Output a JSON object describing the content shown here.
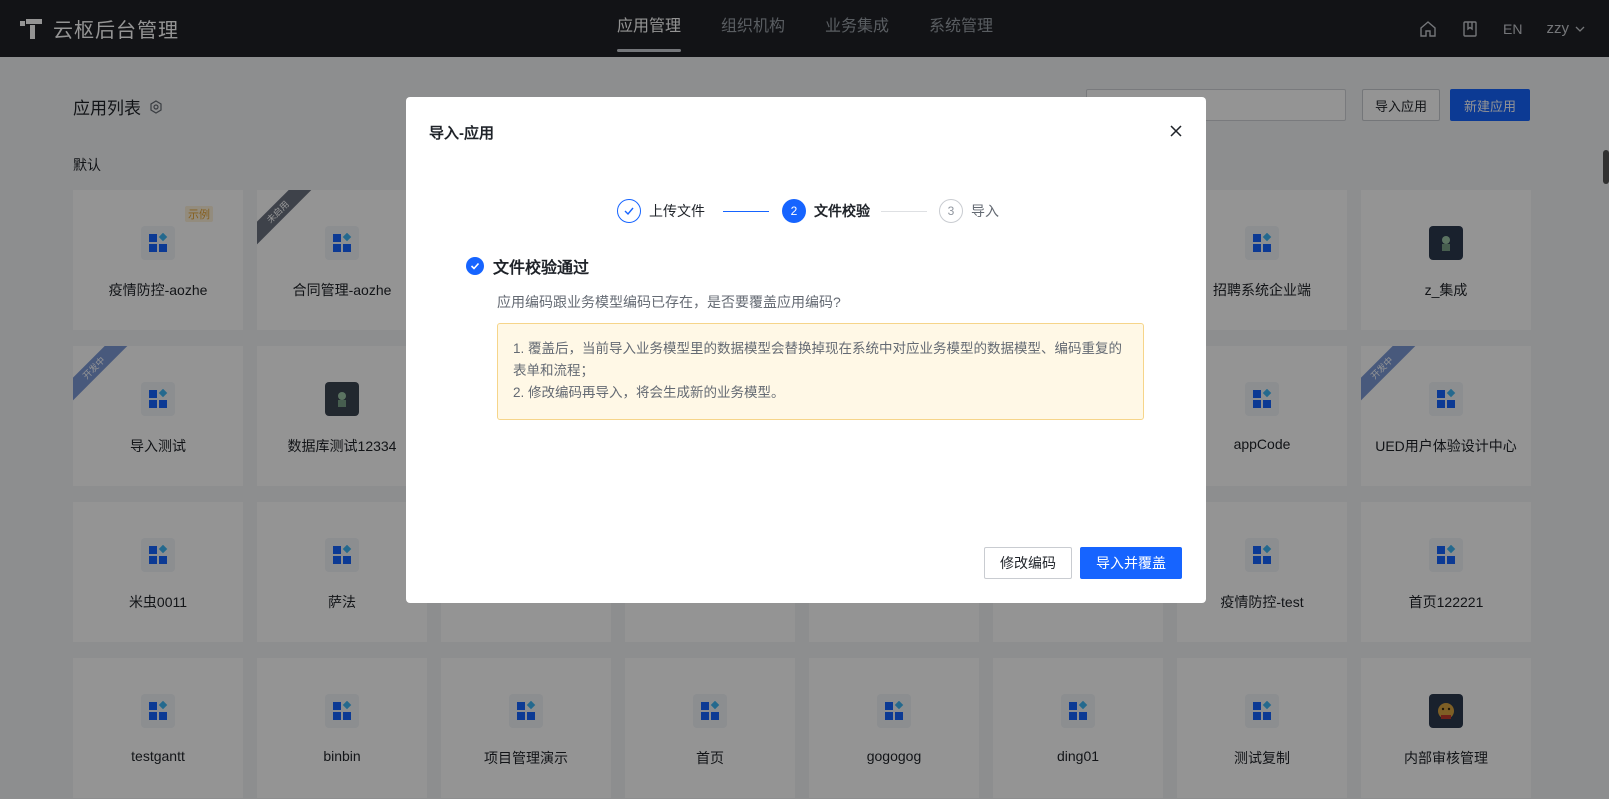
{
  "app": {
    "title": "云枢后台管理"
  },
  "nav": {
    "items": [
      "应用管理",
      "组织机构",
      "业务集成",
      "系统管理"
    ],
    "active": "应用管理"
  },
  "topbar": {
    "home_icon": "home-icon",
    "book_icon": "book-icon",
    "lang": "EN",
    "user": "zzy"
  },
  "page": {
    "title": "应用列表",
    "import_label": "导入应用",
    "new_label": "新建应用",
    "group_label": "默认"
  },
  "cards": [
    {
      "name": "疫情防控-aozhe",
      "badge": "示例",
      "ribbon": "",
      "icon": "apps-icon"
    },
    {
      "name": "合同管理-aozhe",
      "badge": "",
      "ribbon": "未启用",
      "icon": "apps-icon"
    },
    {
      "name": "招聘系统企业端",
      "badge": "",
      "ribbon": "",
      "icon": "apps-icon"
    },
    {
      "name": "z_集成",
      "badge": "",
      "ribbon": "",
      "icon": "image-icon"
    },
    {
      "name": "导入测试",
      "badge": "",
      "ribbon": "开发中",
      "icon": "apps-icon"
    },
    {
      "name": "数据库测试12334",
      "badge": "",
      "ribbon": "",
      "icon": "image-icon"
    },
    {
      "name": "appCode",
      "badge": "",
      "ribbon": "",
      "icon": "apps-icon"
    },
    {
      "name": "UED用户体验设计中心",
      "badge": "",
      "ribbon": "开发中",
      "icon": "apps-icon"
    },
    {
      "name": "米虫0011",
      "badge": "",
      "ribbon": "",
      "icon": "apps-icon"
    },
    {
      "name": "萨法",
      "badge": "",
      "ribbon": "",
      "icon": "apps-icon"
    },
    {
      "name": "疫情防控-test",
      "badge": "",
      "ribbon": "",
      "icon": "apps-icon"
    },
    {
      "name": "首页122221",
      "badge": "",
      "ribbon": "",
      "icon": "apps-icon"
    },
    {
      "name": "testgantt",
      "badge": "",
      "ribbon": "",
      "icon": "apps-icon"
    },
    {
      "name": "binbin",
      "badge": "",
      "ribbon": "",
      "icon": "apps-icon"
    },
    {
      "name": "项目管理演示",
      "badge": "",
      "ribbon": "",
      "icon": "apps-icon"
    },
    {
      "name": "首页",
      "badge": "",
      "ribbon": "",
      "icon": "apps-icon"
    },
    {
      "name": "gogogog",
      "badge": "",
      "ribbon": "",
      "icon": "apps-icon"
    },
    {
      "name": "ding01",
      "badge": "",
      "ribbon": "",
      "icon": "apps-icon"
    },
    {
      "name": "测试复制",
      "badge": "",
      "ribbon": "",
      "icon": "apps-icon"
    },
    {
      "name": "内部审核管理",
      "badge": "",
      "ribbon": "",
      "icon": "image-icon"
    }
  ],
  "modal": {
    "title": "导入-应用",
    "steps": [
      {
        "label": "上传文件",
        "state": "done",
        "num": "1"
      },
      {
        "label": "文件校验",
        "state": "active",
        "num": "2"
      },
      {
        "label": "导入",
        "state": "wait",
        "num": "3"
      }
    ],
    "result_title": "文件校验通过",
    "result_desc": "应用编码跟业务模型编码已存在，是否要覆盖应用编码?",
    "warn_line1": "1. 覆盖后，当前导入业务模型里的数据模型会替换掉现在系统中对应业务模型的数据模型、编码重复的表单和流程；",
    "warn_line2": "2. 修改编码再导入，将会生成新的业务模型。",
    "modify_label": "修改编码",
    "confirm_label": "导入并覆盖"
  },
  "colors": {
    "primary": "#1664ff",
    "topbar": "#1f2126",
    "warn_bg": "#fff8e6",
    "warn_border": "#f6d58a"
  }
}
